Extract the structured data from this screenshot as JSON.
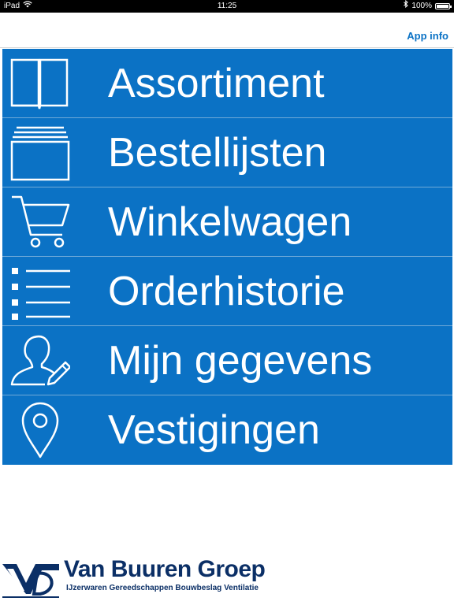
{
  "status_bar": {
    "device": "iPad",
    "time": "11:25",
    "battery": "100%",
    "battery_level": 1.0,
    "icons": [
      "wifi-icon",
      "bluetooth-icon",
      "battery-icon"
    ]
  },
  "nav": {
    "app_info_label": "App info"
  },
  "menu": {
    "items": [
      {
        "label": "Assortiment",
        "icon": "book-icon"
      },
      {
        "label": "Bestellijsten",
        "icon": "stacked-folders-icon"
      },
      {
        "label": "Winkelwagen",
        "icon": "shopping-cart-icon"
      },
      {
        "label": "Orderhistorie",
        "icon": "list-icon"
      },
      {
        "label": "Mijn gegevens",
        "icon": "user-edit-icon"
      },
      {
        "label": "Vestigingen",
        "icon": "location-pin-icon"
      }
    ]
  },
  "logo": {
    "title": "Van Buuren Groep",
    "subtitle": "IJzerwaren Gereedschappen Bouwbeslag Ventilatie"
  },
  "colors": {
    "accent": "#0b72c5",
    "brand_dark": "#0b2f66",
    "divider": "#6fa9d8"
  }
}
